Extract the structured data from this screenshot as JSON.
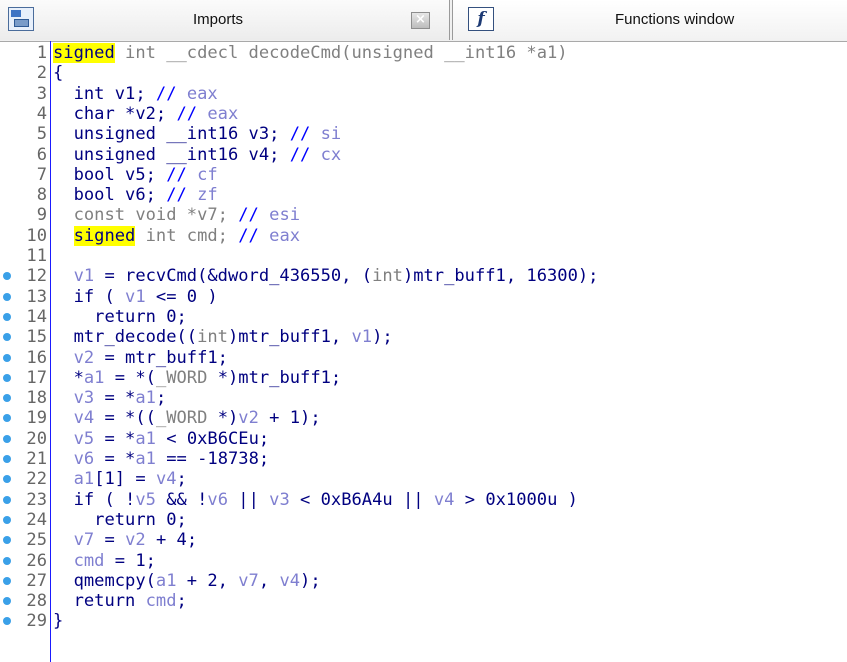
{
  "tabs": {
    "imports": {
      "label": "Imports"
    },
    "functions": {
      "label": "Functions window",
      "icon_glyph": "f"
    }
  },
  "lines": [
    {
      "n": "1",
      "dot": false,
      "html": "<span class=\"hl\">signed</span><span class=\"kwg\"> int __cdecl decodeCmd(unsigned __int16 *a1)</span>"
    },
    {
      "n": "2",
      "dot": false,
      "html": "{"
    },
    {
      "n": "3",
      "dot": false,
      "html": "  int v1; <span class=\"cmt\">//</span> <span class=\"cmtt\">eax</span>"
    },
    {
      "n": "4",
      "dot": false,
      "html": "  char *v2; <span class=\"cmt\">//</span> <span class=\"cmtt\">eax</span>"
    },
    {
      "n": "5",
      "dot": false,
      "html": "  unsigned __int16 v3; <span class=\"cmt\">//</span> <span class=\"cmtt\">si</span>"
    },
    {
      "n": "6",
      "dot": false,
      "html": "  unsigned __int16 v4; <span class=\"cmt\">//</span> <span class=\"cmtt\">cx</span>"
    },
    {
      "n": "7",
      "dot": false,
      "html": "  bool v5; <span class=\"cmt\">//</span> <span class=\"cmtt\">cf</span>"
    },
    {
      "n": "8",
      "dot": false,
      "html": "  bool v6; <span class=\"cmt\">//</span> <span class=\"cmtt\">zf</span>"
    },
    {
      "n": "9",
      "dot": false,
      "html": "  <span class=\"kwg\">const void *v7;</span> <span class=\"cmt\">//</span> <span class=\"cmtt\">esi</span>"
    },
    {
      "n": "10",
      "dot": false,
      "html": "  <span class=\"hl\">signed</span><span class=\"kwg\"> int cmd;</span> <span class=\"cmt\">//</span> <span class=\"cmtt\">eax</span>"
    },
    {
      "n": "11",
      "dot": false,
      "html": ""
    },
    {
      "n": "12",
      "dot": true,
      "html": "  <span class=\"var\">v1</span> = recvCmd(&amp;dword_436550, (<span class=\"kwg\">int</span>)mtr_buff1, 16300);"
    },
    {
      "n": "13",
      "dot": true,
      "html": "  if ( <span class=\"var\">v1</span> &lt;= 0 )"
    },
    {
      "n": "14",
      "dot": true,
      "html": "    return 0;"
    },
    {
      "n": "15",
      "dot": true,
      "html": "  mtr_decode((<span class=\"kwg\">int</span>)mtr_buff1, <span class=\"var\">v1</span>);"
    },
    {
      "n": "16",
      "dot": true,
      "html": "  <span class=\"var\">v2</span> = mtr_buff1;"
    },
    {
      "n": "17",
      "dot": true,
      "html": "  *<span class=\"var\">a1</span> = *(<span class=\"kwg\">_WORD</span> *)mtr_buff1;"
    },
    {
      "n": "18",
      "dot": true,
      "html": "  <span class=\"var\">v3</span> = *<span class=\"var\">a1</span>;"
    },
    {
      "n": "19",
      "dot": true,
      "html": "  <span class=\"var\">v4</span> = *((<span class=\"kwg\">_WORD</span> *)<span class=\"var\">v2</span> + 1);"
    },
    {
      "n": "20",
      "dot": true,
      "html": "  <span class=\"var\">v5</span> = *<span class=\"var\">a1</span> &lt; 0xB6CEu;"
    },
    {
      "n": "21",
      "dot": true,
      "html": "  <span class=\"var\">v6</span> = *<span class=\"var\">a1</span> == -18738;"
    },
    {
      "n": "22",
      "dot": true,
      "html": "  <span class=\"var\">a1</span>[1] = <span class=\"var\">v4</span>;"
    },
    {
      "n": "23",
      "dot": true,
      "html": "  if ( !<span class=\"var\">v5</span> &amp;&amp; !<span class=\"var\">v6</span> || <span class=\"var\">v3</span> &lt; 0xB6A4u || <span class=\"var\">v4</span> &gt; 0x1000u )"
    },
    {
      "n": "24",
      "dot": true,
      "html": "    return 0;"
    },
    {
      "n": "25",
      "dot": true,
      "html": "  <span class=\"var\">v7</span> = <span class=\"var\">v2</span> + 4;"
    },
    {
      "n": "26",
      "dot": true,
      "html": "  <span class=\"var\">cmd</span> = 1;"
    },
    {
      "n": "27",
      "dot": true,
      "html": "  qmemcpy(<span class=\"var\">a1</span> + 2, <span class=\"var\">v7</span>, <span class=\"var\">v4</span>);"
    },
    {
      "n": "28",
      "dot": true,
      "html": "  return <span class=\"var\">cmd</span>;"
    },
    {
      "n": "29",
      "dot": true,
      "html": "}"
    }
  ]
}
